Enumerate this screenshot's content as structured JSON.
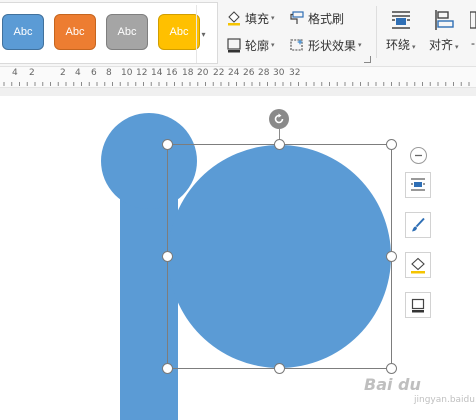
{
  "ribbon": {
    "shape_styles": [
      {
        "label": "Abc",
        "fill": "#5b9bd5",
        "border": "#41719c"
      },
      {
        "label": "Abc",
        "fill": "#ed7d31",
        "border": "#c5651f"
      },
      {
        "label": "Abc",
        "fill": "#a5a5a5",
        "border": "#7f7f7f"
      },
      {
        "label": "Abc",
        "fill": "#ffc000",
        "border": "#d19e00"
      }
    ],
    "fill_label": "填充",
    "outline_label": "轮廓",
    "format_painter_label": "格式刷",
    "shape_effects_label": "形状效果",
    "wrap_label": "环绕",
    "align_label": "对齐",
    "extra_label": "-"
  },
  "ruler": {
    "labels": [
      "4",
      "2",
      "2",
      "4",
      "6",
      "8",
      "10",
      "12",
      "14",
      "16",
      "18",
      "20",
      "22",
      "24",
      "26",
      "28",
      "30",
      "32"
    ]
  },
  "canvas": {
    "shape_color": "#5b9bd5"
  },
  "watermark": {
    "text": "Bai du",
    "sub": "jingyan.baidu.com"
  },
  "icons": {
    "fill": "paint-bucket-icon",
    "outline": "shape-outline-icon",
    "format_painter": "format-painter-icon",
    "shape_effects": "shape-effects-icon",
    "wrap": "text-wrap-icon",
    "align": "align-icon",
    "rotate": "rotate-icon"
  }
}
